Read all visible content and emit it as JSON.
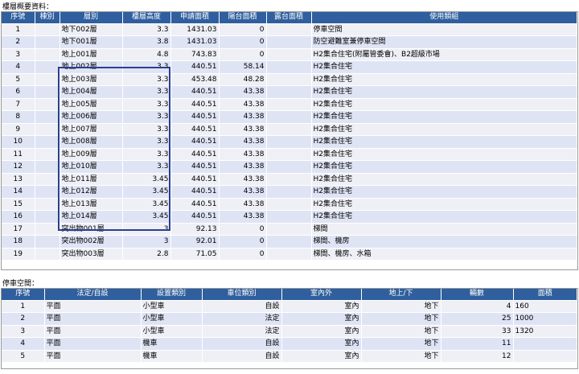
{
  "floors_section": {
    "title": "樓層概要資料：",
    "columns": [
      "序號",
      "棟別",
      "層別",
      "樓層高度",
      "申請面積",
      "陽台面積",
      "露台面積",
      "使用類組"
    ],
    "rows": [
      [
        "1",
        "",
        "地下002層",
        "3.3",
        "1431.03",
        "0",
        "",
        "停車空間"
      ],
      [
        "2",
        "",
        "地下001層",
        "3.8",
        "1431.03",
        "0",
        "",
        "防空避難室兼停車空間"
      ],
      [
        "3",
        "",
        "地上001層",
        "4.8",
        "743.83",
        "0",
        "",
        "H2集合住宅(附屬管委會)、B2超級市場"
      ],
      [
        "4",
        "",
        "地上002層",
        "3.3",
        "440.51",
        "58.14",
        "",
        "H2集合住宅"
      ],
      [
        "5",
        "",
        "地上003層",
        "3.3",
        "453.48",
        "48.28",
        "",
        "H2集合住宅"
      ],
      [
        "6",
        "",
        "地上004層",
        "3.3",
        "440.51",
        "43.38",
        "",
        "H2集合住宅"
      ],
      [
        "7",
        "",
        "地上005層",
        "3.3",
        "440.51",
        "43.38",
        "",
        "H2集合住宅"
      ],
      [
        "8",
        "",
        "地上006層",
        "3.3",
        "440.51",
        "43.38",
        "",
        "H2集合住宅"
      ],
      [
        "9",
        "",
        "地上007層",
        "3.3",
        "440.51",
        "43.38",
        "",
        "H2集合住宅"
      ],
      [
        "10",
        "",
        "地上008層",
        "3.3",
        "440.51",
        "43.38",
        "",
        "H2集合住宅"
      ],
      [
        "11",
        "",
        "地上009層",
        "3.3",
        "440.51",
        "43.38",
        "",
        "H2集合住宅"
      ],
      [
        "12",
        "",
        "地上010層",
        "3.3",
        "440.51",
        "43.38",
        "",
        "H2集合住宅"
      ],
      [
        "13",
        "",
        "地上011層",
        "3.45",
        "440.51",
        "43.38",
        "",
        "H2集合住宅"
      ],
      [
        "14",
        "",
        "地上012層",
        "3.45",
        "440.51",
        "43.38",
        "",
        "H2集合住宅"
      ],
      [
        "15",
        "",
        "地上013層",
        "3.45",
        "440.51",
        "43.38",
        "",
        "H2集合住宅"
      ],
      [
        "16",
        "",
        "地上014層",
        "3.45",
        "440.51",
        "43.38",
        "",
        "H2集合住宅"
      ],
      [
        "17",
        "",
        "突出物001層",
        "3",
        "92.13",
        "0",
        "",
        "梯間"
      ],
      [
        "18",
        "",
        "突出物002層",
        "3",
        "92.01",
        "0",
        "",
        "梯間、機房"
      ],
      [
        "19",
        "",
        "突出物003層",
        "2.8",
        "71.05",
        "0",
        "",
        "梯間、機房、水箱"
      ]
    ]
  },
  "parking_section": {
    "title": "停車空間：",
    "columns": [
      "序號",
      "法定/自設",
      "設置類別",
      "車位類別",
      "室內外",
      "地上/下",
      "輛數",
      "面積"
    ],
    "rows": [
      [
        "1",
        "平面",
        "小型車",
        "自設",
        "室內",
        "地下",
        "4",
        "160"
      ],
      [
        "2",
        "平面",
        "小型車",
        "法定",
        "室內",
        "地下",
        "25",
        "1000"
      ],
      [
        "3",
        "平面",
        "小型車",
        "法定",
        "室內",
        "地下",
        "33",
        "1320"
      ],
      [
        "4",
        "平面",
        "機車",
        "自設",
        "室內",
        "地下",
        "11",
        ""
      ],
      [
        "5",
        "平面",
        "機車",
        "自設",
        "室內",
        "地下",
        "12",
        ""
      ]
    ]
  },
  "colors": {
    "header_bg": "#2f5f9e",
    "row_light": "#eff0f6",
    "row_dark": "#dfe4f5",
    "highlight_box": "#2b3f8f"
  }
}
